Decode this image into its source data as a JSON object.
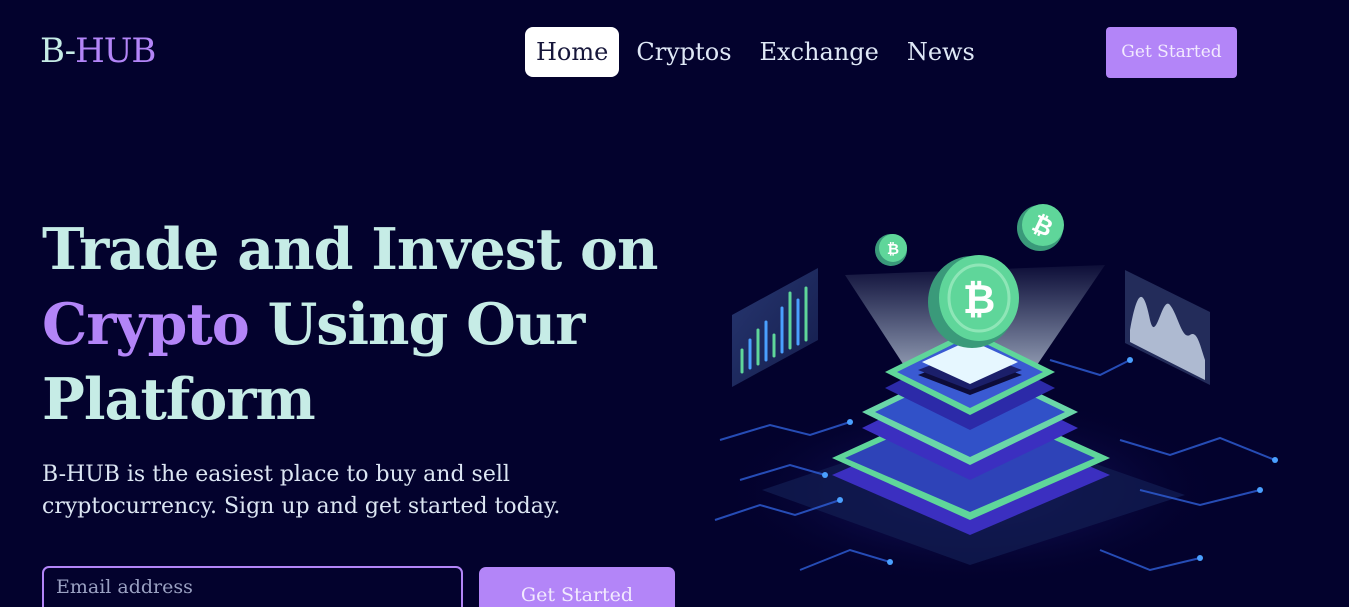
{
  "brand": {
    "prefix": "B-",
    "suffix": "HUB"
  },
  "nav": {
    "items": [
      {
        "label": "Home",
        "active": true
      },
      {
        "label": "Cryptos",
        "active": false
      },
      {
        "label": "Exchange",
        "active": false
      },
      {
        "label": "News",
        "active": false
      }
    ],
    "cta_label": "Get Started"
  },
  "hero": {
    "title_part1": "Trade and Invest on",
    "title_accent": "Crypto",
    "title_part2": " Using Our",
    "title_part3": "Platform",
    "subtitle": "B-HUB is the easiest place to buy and sell cryptocurrency. Sign up and get started today.",
    "email_placeholder": "Email address",
    "cta_label": "Get Started"
  },
  "illustration": {
    "icon": "bitcoin-platform-icon"
  },
  "colors": {
    "background": "#03022d",
    "accent": "#b385f8",
    "heading": "#c6ece6",
    "coin": "#5fd69a"
  }
}
